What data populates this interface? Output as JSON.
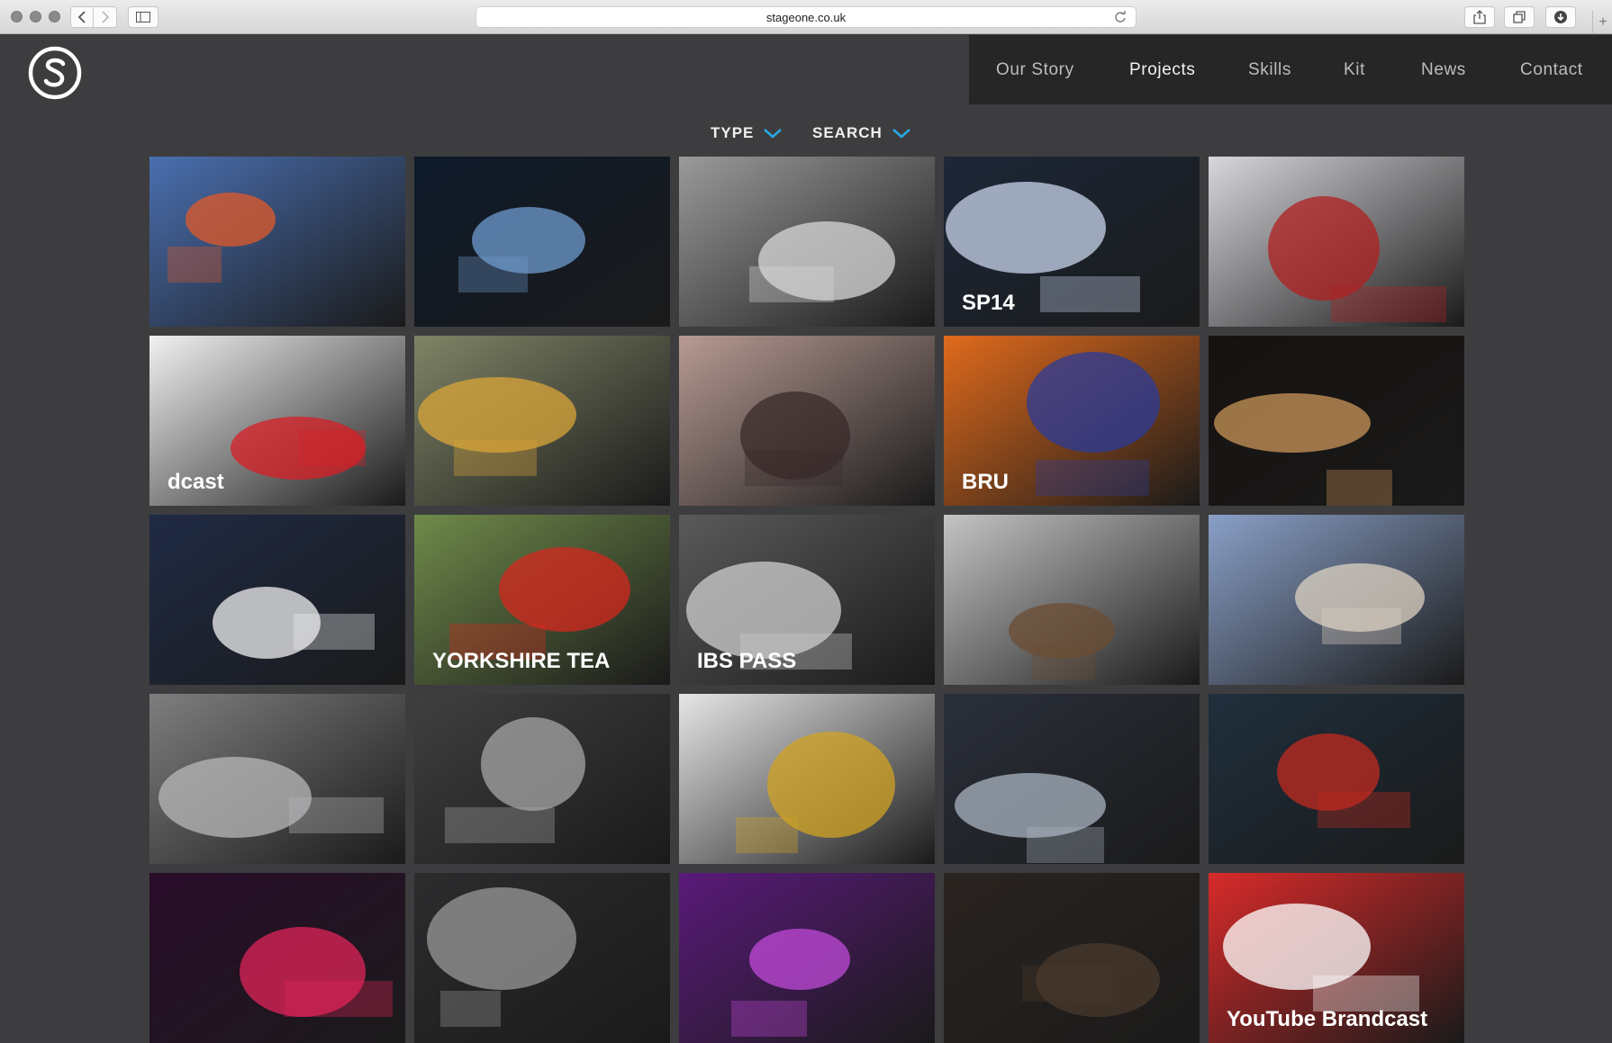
{
  "browser": {
    "url": "stageone.co.uk",
    "icons": [
      "back-icon",
      "forward-icon",
      "sidebar-icon",
      "reload-icon",
      "share-icon",
      "tabs-icon",
      "download-icon",
      "plus-icon"
    ]
  },
  "site": {
    "logo_letter": "S",
    "nav": [
      {
        "label": "Our Story",
        "active": false
      },
      {
        "label": "Projects",
        "active": true
      },
      {
        "label": "Skills",
        "active": false
      },
      {
        "label": "Kit",
        "active": false
      },
      {
        "label": "News",
        "active": false
      },
      {
        "label": "Contact",
        "active": false
      }
    ],
    "filters": [
      {
        "label": "TYPE",
        "icon": "chevron-down-icon"
      },
      {
        "label": "SEARCH",
        "icon": "chevron-down-icon"
      }
    ],
    "accent_color": "#29a8e0"
  },
  "projects": {
    "tiles": [
      {
        "caption": "",
        "bg": "#4a6fb0",
        "accent": "#e05a2a"
      },
      {
        "caption": "",
        "bg": "#0e1a2a",
        "accent": "#6f9ccf"
      },
      {
        "caption": "",
        "bg": "#9a9a9a",
        "accent": "#d8d8d8"
      },
      {
        "caption": "SP14",
        "bg": "#1d2738",
        "accent": "#c9d6ee"
      },
      {
        "caption": "",
        "bg": "#d7d7dc",
        "accent": "#b02020"
      },
      {
        "caption": "dcast",
        "bg": "#f1f1f1",
        "accent": "#d81f26"
      },
      {
        "caption": "",
        "bg": "#7f8466",
        "accent": "#d9a63a"
      },
      {
        "caption": "",
        "bg": "#b79a93",
        "accent": "#3a2a2a"
      },
      {
        "caption": "BRU",
        "bg": "#e06a1c",
        "accent": "#2b3b9a"
      },
      {
        "caption": "",
        "bg": "#161210",
        "accent": "#c9965a"
      },
      {
        "caption": "",
        "bg": "#1f2a44",
        "accent": "#f0f0f0"
      },
      {
        "caption": "YORKSHIRE TEA",
        "bg": "#6f8a4a",
        "accent": "#d6271e"
      },
      {
        "caption": "IBS PASS",
        "bg": "#5a5a5a",
        "accent": "#cfcfcf"
      },
      {
        "caption": "",
        "bg": "#c4c4c4",
        "accent": "#6b4e34"
      },
      {
        "caption": "",
        "bg": "#8aa0c8",
        "accent": "#dcd2c2"
      },
      {
        "caption": "",
        "bg": "#7e7e80",
        "accent": "#b8b8ba"
      },
      {
        "caption": "",
        "bg": "#3f3f40",
        "accent": "#a6a6a6"
      },
      {
        "caption": "",
        "bg": "#e6e6e6",
        "accent": "#d2a322"
      },
      {
        "caption": "",
        "bg": "#2a2f3a",
        "accent": "#aab4c0"
      },
      {
        "caption": "",
        "bg": "#1f2f3c",
        "accent": "#c22a20"
      },
      {
        "caption": "",
        "bg": "#2a0d2a",
        "accent": "#e0245a"
      },
      {
        "caption": "",
        "bg": "#2c2c2e",
        "accent": "#9a9a9a"
      },
      {
        "caption": "",
        "bg": "#5a1a7a",
        "accent": "#c04ad8"
      },
      {
        "caption": "",
        "bg": "#2a2420",
        "accent": "#4a3a2c"
      },
      {
        "caption": "YouTube Brandcast",
        "bg": "#d82a2a",
        "accent": "#ffffff"
      }
    ]
  }
}
